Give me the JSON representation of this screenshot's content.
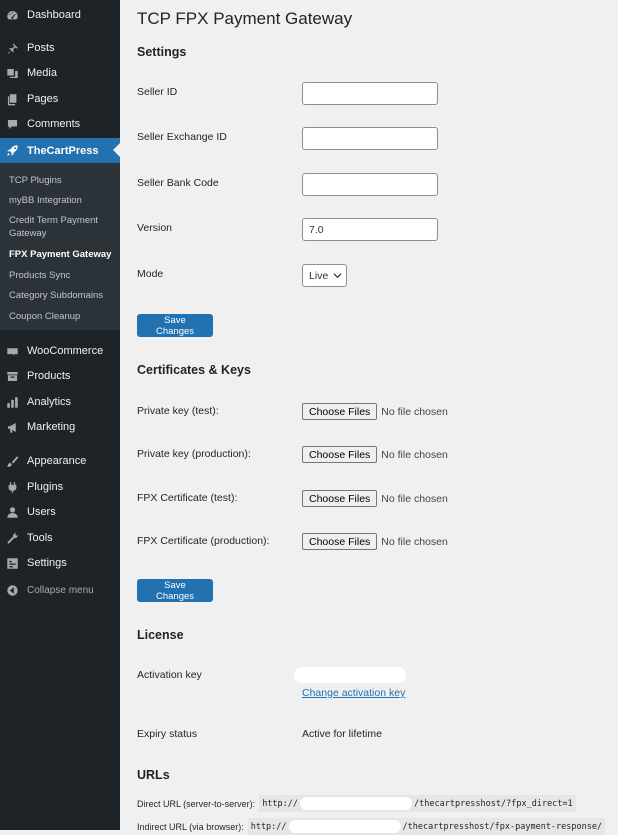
{
  "sidebar": {
    "top_items": [
      {
        "label": "Dashboard",
        "icon": "dashboard-icon"
      },
      {
        "label": "Posts",
        "icon": "pin-icon"
      },
      {
        "label": "Media",
        "icon": "media-icon"
      },
      {
        "label": "Pages",
        "icon": "pages-icon"
      },
      {
        "label": "Comments",
        "icon": "comment-icon"
      },
      {
        "label": "TheCartPress",
        "icon": "rocket-icon"
      }
    ],
    "submenu": [
      "TCP Plugins",
      "myBB Integration",
      "Credit Term Payment Gateway",
      "FPX Payment Gateway",
      "Products Sync",
      "Category Subdomains",
      "Coupon Cleanup"
    ],
    "bottom_items": [
      {
        "label": "WooCommerce",
        "icon": "woocommerce-icon"
      },
      {
        "label": "Products",
        "icon": "archive-icon"
      },
      {
        "label": "Analytics",
        "icon": "analytics-icon"
      },
      {
        "label": "Marketing",
        "icon": "megaphone-icon"
      },
      {
        "label": "Appearance",
        "icon": "brush-icon"
      },
      {
        "label": "Plugins",
        "icon": "plugin-icon"
      },
      {
        "label": "Users",
        "icon": "users-icon"
      },
      {
        "label": "Tools",
        "icon": "wrench-icon"
      },
      {
        "label": "Settings",
        "icon": "settings-icon"
      }
    ],
    "collapse_label": "Collapse menu",
    "active_color": "#2271b1"
  },
  "main": {
    "title": "TCP FPX Payment Gateway",
    "settings": {
      "heading": "Settings",
      "fields": {
        "seller_id": {
          "label": "Seller ID",
          "value": ""
        },
        "seller_exchange_id": {
          "label": "Seller Exchange ID",
          "value": ""
        },
        "seller_bank_code": {
          "label": "Seller Bank Code",
          "value": ""
        },
        "version": {
          "label": "Version",
          "value": "7.0"
        },
        "mode": {
          "label": "Mode",
          "value": "Live"
        }
      },
      "save_label": "Save Changes"
    },
    "certificates": {
      "heading": "Certificates & Keys",
      "rows": [
        {
          "label": "Private key (test):",
          "button": "Choose Files",
          "status": "No file chosen"
        },
        {
          "label": "Private key (production):",
          "button": "Choose Files",
          "status": "No file chosen"
        },
        {
          "label": "FPX Certificate (test):",
          "button": "Choose Files",
          "status": "No file chosen"
        },
        {
          "label": "FPX Certificate (production):",
          "button": "Choose Files",
          "status": "No file chosen"
        }
      ],
      "save_label": "Save Changes"
    },
    "license": {
      "heading": "License",
      "activation_label": "Activation key",
      "change_link": "Change activation key",
      "expiry_label": "Expiry status",
      "expiry_value": "Active for lifetime"
    },
    "urls": {
      "heading": "URLs",
      "direct_label": "Direct URL (server-to-server):",
      "direct_prefix": "http://",
      "direct_suffix": "/thecartpresshost/?fpx_direct=1",
      "indirect_label": "Indirect URL (via browser):",
      "indirect_prefix": "http://",
      "indirect_suffix": "/thecartpresshost/fpx-payment-response/"
    }
  }
}
